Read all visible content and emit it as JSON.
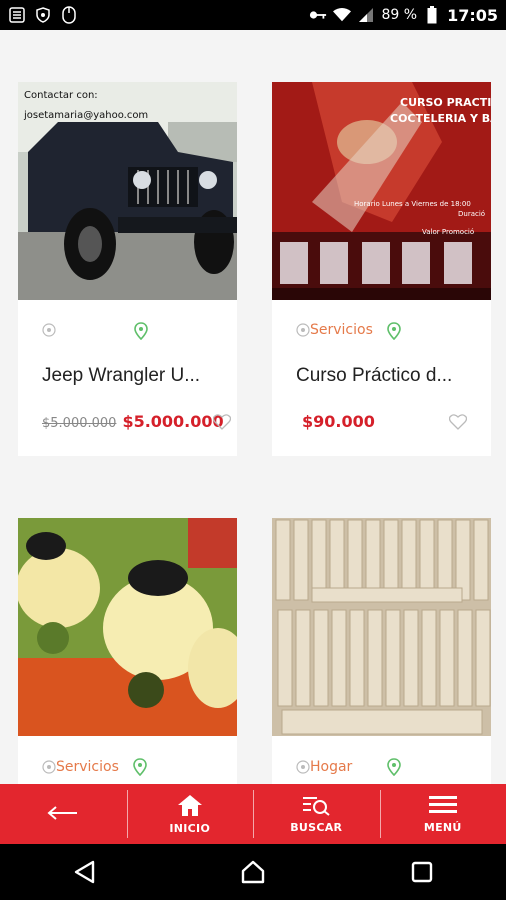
{
  "status_bar": {
    "battery_percent": "89 %",
    "time": "17:05",
    "icons": [
      "menu-icon",
      "shield-icon",
      "mouse-icon",
      "key-icon",
      "wifi-icon",
      "signal-icon",
      "battery-icon"
    ]
  },
  "listings": [
    {
      "title": "Jeep Wrangler U...",
      "category": "",
      "old_price": "$5.000.000",
      "price": "$5.000.000",
      "image_text": [
        "Contactar con:",
        "josetamaria@yahoo.com"
      ]
    },
    {
      "title": "Curso Práctico d...",
      "category": "Servicios",
      "old_price": "",
      "price": "$90.000",
      "image_text": [
        "CURSO PRACTIC",
        "COCTELERIA Y BAR",
        "Horario Lunes a Viernes de 18:00",
        "Duració",
        "Valor Promoció"
      ]
    },
    {
      "title": "",
      "category": "Servicios",
      "old_price": "",
      "price": ""
    },
    {
      "title": "",
      "category": "Hogar",
      "old_price": "",
      "price": ""
    }
  ],
  "bottom_nav": {
    "back_icon": "arrow-left-icon",
    "home_label": "INICIO",
    "search_label": "BUSCAR",
    "menu_label": "MENÚ"
  },
  "colors": {
    "accent": "#e3262e",
    "price": "#d5202a",
    "category": "#e57a4a",
    "pin": "#5fbf6a"
  }
}
